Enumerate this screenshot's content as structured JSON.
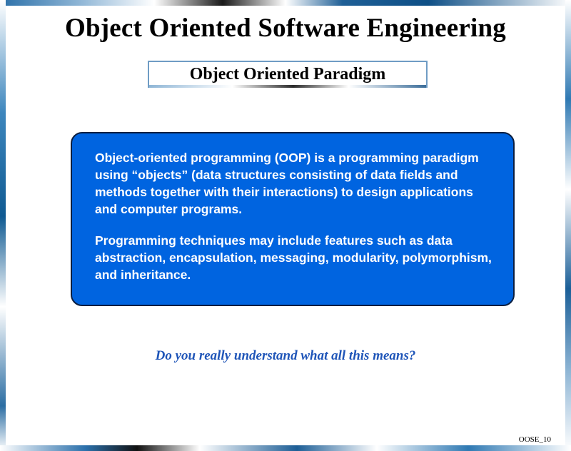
{
  "slide": {
    "title": "Object Oriented Software Engineering",
    "subtitle": "Object Oriented Paradigm",
    "paragraphs": [
      "Object-oriented programming (OOP) is a programming paradigm using “objects” (data structures consisting of data fields and methods together with their interactions) to design applications and computer programs.",
      "Programming techniques may include features such as data abstraction, encapsulation, messaging, modularity, polymorphism, and inheritance."
    ],
    "question": "Do you really understand what all this means?",
    "slide_number": "OOSE_10"
  },
  "colors": {
    "content_box_fill": "#0064e0",
    "question_text": "#1f55b8",
    "title_text": "#000000"
  }
}
